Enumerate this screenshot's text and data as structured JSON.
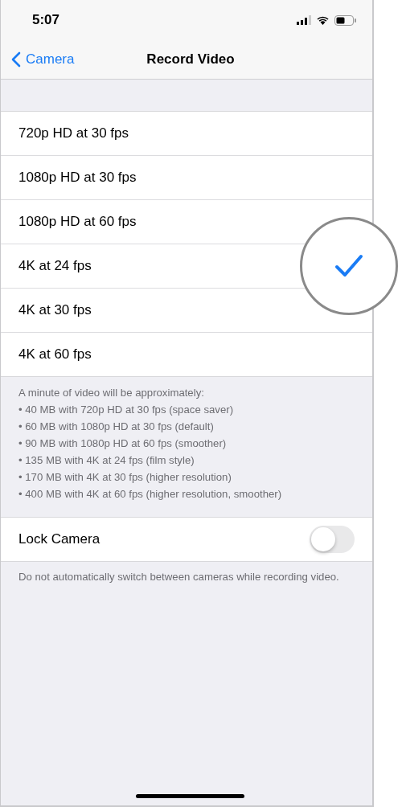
{
  "status_bar": {
    "time": "5:07"
  },
  "nav": {
    "back": "Camera",
    "title": "Record Video"
  },
  "options": [
    {
      "label": "720p HD at 30 fps",
      "selected": false
    },
    {
      "label": "1080p HD at 30 fps",
      "selected": false
    },
    {
      "label": "1080p HD at 60 fps",
      "selected": false
    },
    {
      "label": "4K at 24 fps",
      "selected": true
    },
    {
      "label": "4K at 30 fps",
      "selected": false
    },
    {
      "label": "4K at 60 fps",
      "selected": false
    }
  ],
  "options_footer": [
    "A minute of video will be approximately:",
    "• 40 MB with 720p HD at 30 fps (space saver)",
    "• 60 MB with 1080p HD at 30 fps (default)",
    "• 90 MB with 1080p HD at 60 fps (smoother)",
    "• 135 MB with 4K at 24 fps (film style)",
    "• 170 MB with 4K at 30 fps (higher resolution)",
    "• 400 MB with 4K at 60 fps (higher resolution, smoother)"
  ],
  "lock_camera": {
    "label": "Lock Camera",
    "on": false
  },
  "lock_footer": "Do not automatically switch between cameras while recording video."
}
